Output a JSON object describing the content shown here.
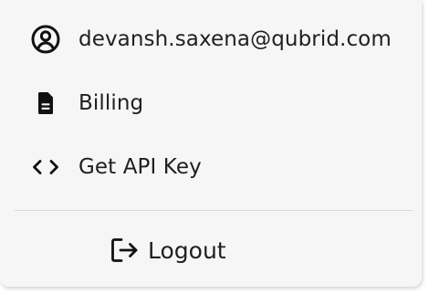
{
  "menu": {
    "items": [
      {
        "label": "devansh.saxena@qubrid.com",
        "icon": "user-circle-icon"
      },
      {
        "label": "Billing",
        "icon": "document-icon"
      },
      {
        "label": "Get API Key",
        "icon": "code-icon"
      }
    ],
    "logout": {
      "label": "Logout",
      "icon": "logout-icon"
    }
  }
}
